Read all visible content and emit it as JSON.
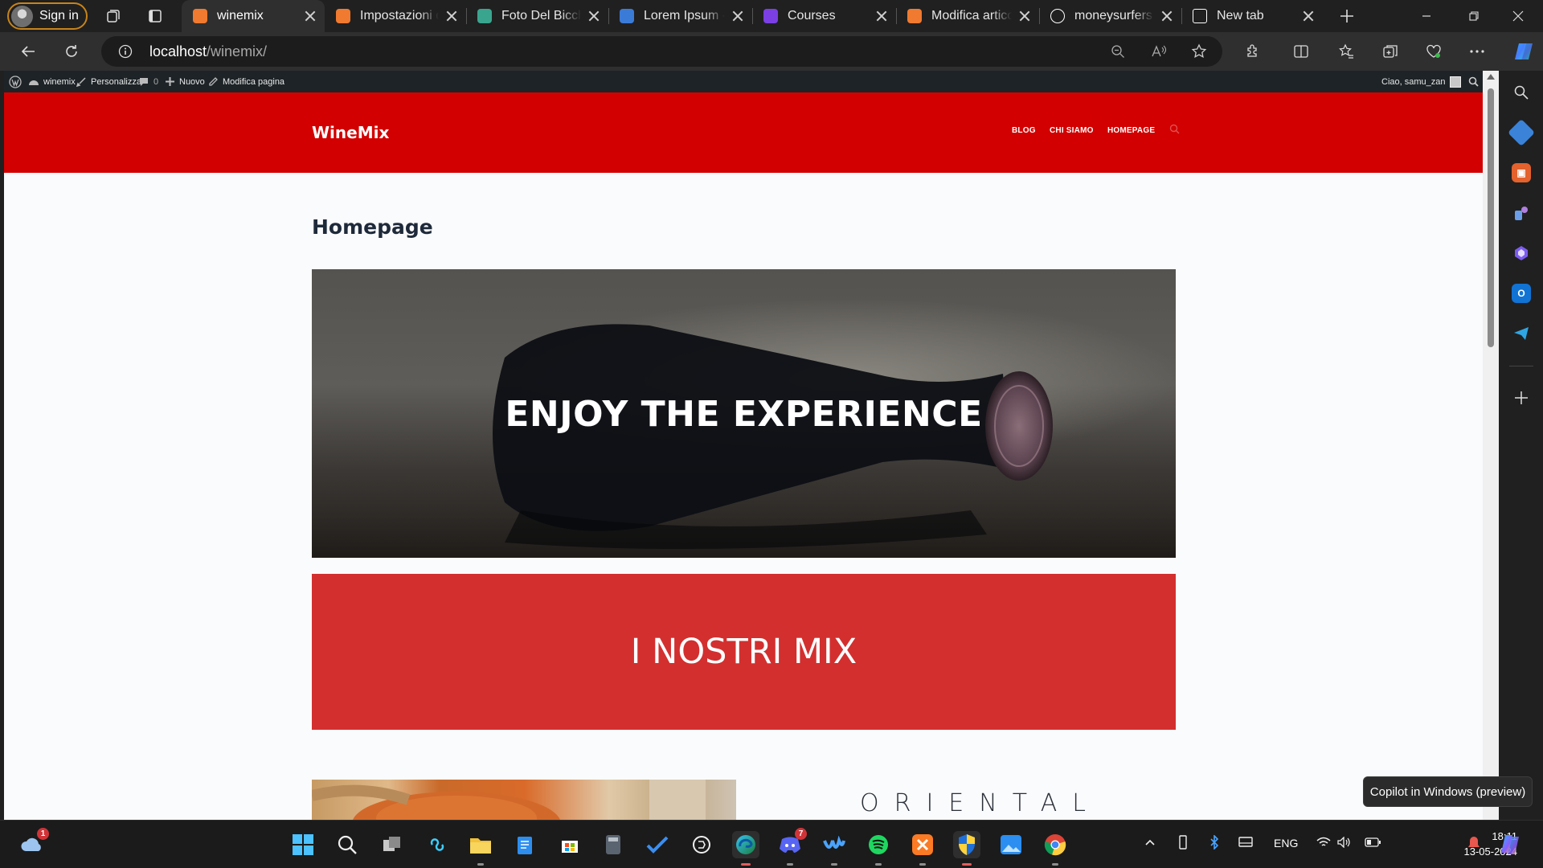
{
  "browser": {
    "signin_label": "Sign in",
    "tabs": [
      {
        "title": "winemix",
        "favicon": "xampp-icon",
        "color": "#f07a2f",
        "active": true
      },
      {
        "title": "Impostazioni d",
        "favicon": "xampp-icon",
        "color": "#f07a2f",
        "active": false
      },
      {
        "title": "Foto Del Bicch",
        "favicon": "page-icon",
        "color": "#3aa58f",
        "active": false
      },
      {
        "title": "Lorem Ipsum -",
        "favicon": "feather-icon",
        "color": "#3b7bd8",
        "active": false
      },
      {
        "title": "Courses",
        "favicon": "courses-icon",
        "color": "#7b3fe4",
        "active": false
      },
      {
        "title": "Modifica artico",
        "favicon": "xampp-icon",
        "color": "#f07a2f",
        "active": false
      },
      {
        "title": "moneysurfers |",
        "favicon": "google-icon",
        "color": "#ffffff",
        "active": false
      },
      {
        "title": "New tab",
        "favicon": "newtab-icon",
        "color": "#ffffff",
        "active": false
      }
    ],
    "url_host": "localhost",
    "url_path": "/winemix/"
  },
  "adminbar": {
    "site_name": "winemix",
    "customize": "Personalizza",
    "comments_count": "0",
    "new_label": "Nuovo",
    "edit_label": "Modifica pagina",
    "greeting": "Ciao, samu_zan"
  },
  "site": {
    "logo": "WineMix",
    "menu": [
      "BLOG",
      "CHI SIAMO",
      "HOMEPAGE"
    ],
    "page_title": "Homepage",
    "hero_text": "ENJOY THE EXPERIENCE",
    "banner_text": "I NOSTRI MIX",
    "section_title": "ORIENTAL",
    "header_color": "#d20000",
    "banner_color": "#d32f2f"
  },
  "tooltip": "Copilot in Windows (preview)",
  "taskbar": {
    "weather_badge": "1",
    "discord_badge": "7",
    "language": "ENG",
    "time": "18:11",
    "date": "13-05-2024"
  }
}
